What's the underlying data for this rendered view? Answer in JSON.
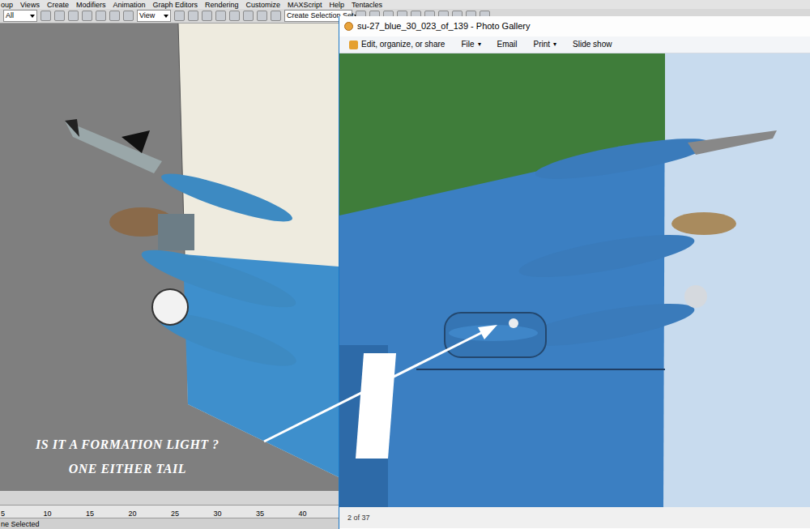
{
  "app_menu": [
    "oup",
    "Views",
    "Create",
    "Modifiers",
    "Animation",
    "Graph Editors",
    "Rendering",
    "Customize",
    "MAXScript",
    "Help",
    "Tentacles"
  ],
  "toolbar": {
    "filter": "All",
    "coord": "View",
    "selection_set": "Create Selection Set"
  },
  "timeline": {
    "ticks": [
      "5",
      "10",
      "15",
      "20",
      "25",
      "30",
      "35",
      "40"
    ],
    "status": "ne Selected"
  },
  "gallery": {
    "title": "su-27_blue_30_023_of_139 - Photo Gallery",
    "menu": [
      {
        "label": "Edit, organize, or share",
        "dropdown": false
      },
      {
        "label": "File",
        "dropdown": true
      },
      {
        "label": "Email",
        "dropdown": false
      },
      {
        "label": "Print",
        "dropdown": true
      },
      {
        "label": "Slide show",
        "dropdown": false
      }
    ],
    "dropdown_glyph": "▾",
    "counter": "2 of 37"
  },
  "annotation": {
    "lines": [
      "IS IT A FORMATION LIGHT ?",
      "ONE EITHER TAIL"
    ]
  }
}
